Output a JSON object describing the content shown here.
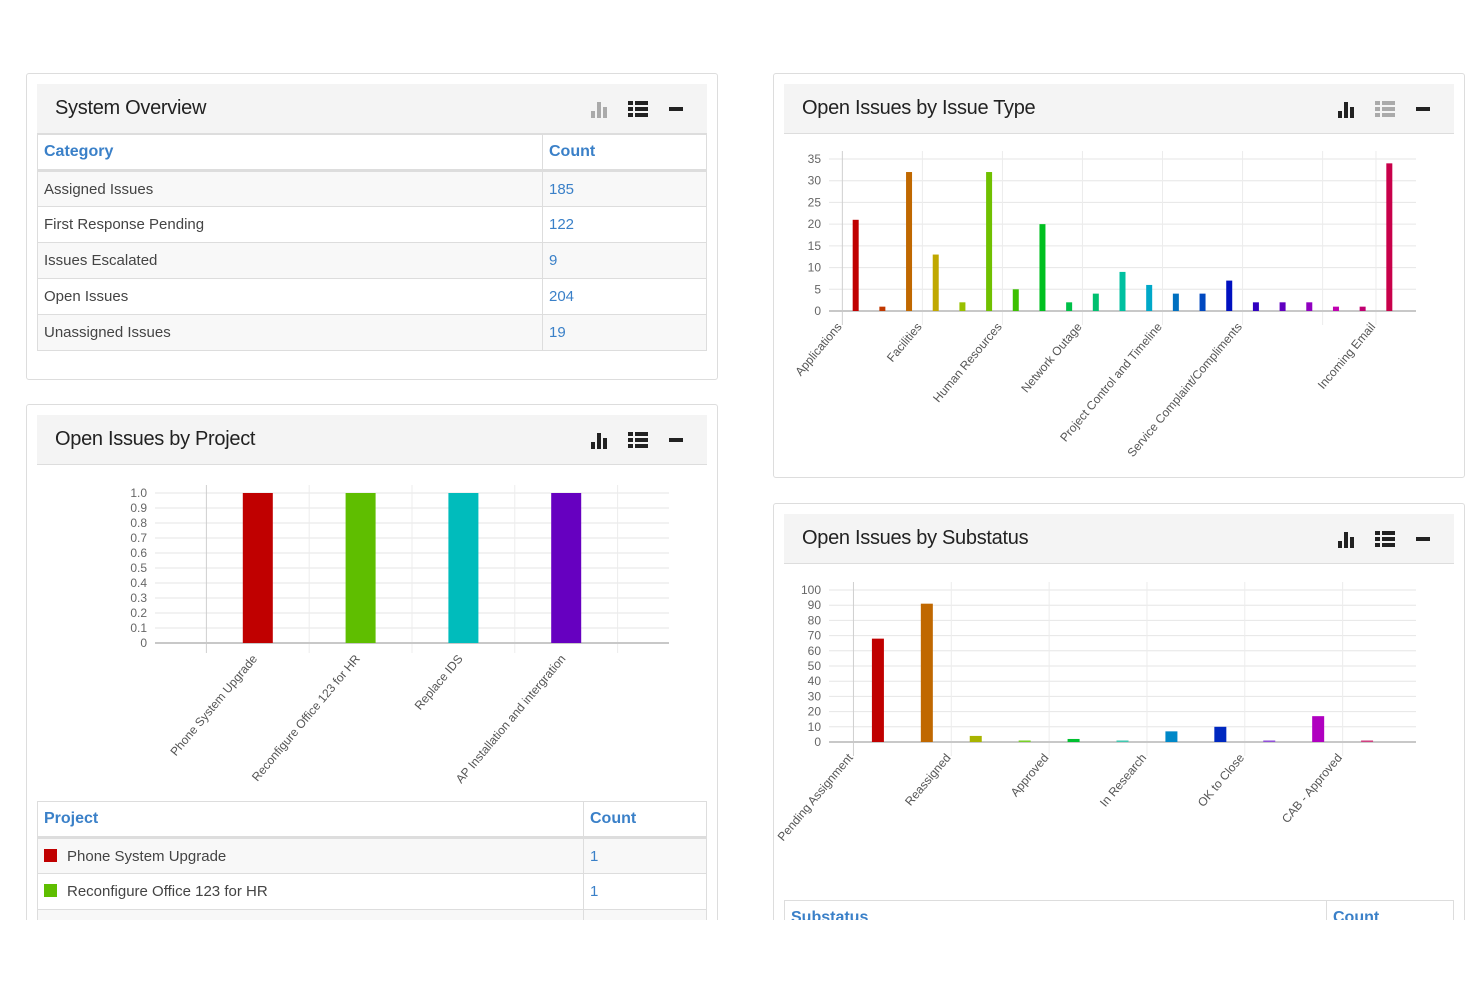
{
  "panels": {
    "system_overview": {
      "title": "System Overview",
      "columns": [
        "Category",
        "Count"
      ],
      "rows": [
        {
          "category": "Assigned Issues",
          "count": "185"
        },
        {
          "category": "First Response Pending",
          "count": "122"
        },
        {
          "category": "Issues Escalated",
          "count": "9"
        },
        {
          "category": "Open Issues",
          "count": "204"
        },
        {
          "category": "Unassigned Issues",
          "count": "19"
        }
      ],
      "active_view": "table"
    },
    "by_project": {
      "title": "Open Issues by Project",
      "columns": [
        "Project",
        "Count"
      ],
      "rows": [
        {
          "project": "Phone System Upgrade",
          "count": "1",
          "color": "#c00000"
        },
        {
          "project": "Reconfigure Office 123 for HR",
          "count": "1",
          "color": "#5fbe00"
        }
      ],
      "active_view": "chart+table"
    },
    "by_issue_type": {
      "title": "Open Issues by Issue Type",
      "active_view": "chart"
    },
    "by_substatus": {
      "title": "Open Issues by Substatus",
      "columns": [
        "Substatus",
        "Count"
      ],
      "active_view": "chart+table"
    }
  },
  "tools": {
    "chart_icon": "bar-chart-icon",
    "table_icon": "list-icon",
    "minimize_icon": "minus-icon"
  },
  "chart_data": [
    {
      "id": "by_project",
      "type": "bar",
      "title": "Open Issues by Project",
      "categories": [
        "Phone System Upgrade",
        "Reconfigure Office 123 for HR",
        "Replace IDS",
        "AP Installation and intergration"
      ],
      "values": [
        1,
        1,
        1,
        1
      ],
      "colors": [
        "#c00000",
        "#5fbe00",
        "#00bcbc",
        "#6600c0"
      ],
      "ylim": [
        0,
        1.0
      ],
      "yticks": [
        "0",
        "0.1",
        "0.2",
        "0.3",
        "0.4",
        "0.5",
        "0.6",
        "0.7",
        "0.8",
        "0.9",
        "1.0"
      ],
      "xlabel": "",
      "ylabel": "",
      "grid": true,
      "legend": "none"
    },
    {
      "id": "by_issue_type",
      "type": "bar",
      "title": "Open Issues by Issue Type",
      "categories": [
        "Applications",
        "",
        "",
        "Facilities",
        "",
        "",
        "Human Resources",
        "",
        "",
        "Network Outage",
        "",
        "",
        "Project Control and Timeline",
        "",
        "",
        "Service Complaint/Compliments",
        "",
        "",
        "",
        "",
        "Incoming Email"
      ],
      "values": [
        21,
        1,
        32,
        13,
        2,
        32,
        5,
        20,
        2,
        4,
        9,
        6,
        4,
        4,
        7,
        2,
        2,
        2,
        1,
        1,
        34
      ],
      "colors": [
        "#c00000",
        "#c03800",
        "#c06800",
        "#c0a800",
        "#98c000",
        "#70c000",
        "#3cc000",
        "#00c020",
        "#00c048",
        "#00c070",
        "#00c0a0",
        "#00a8c8",
        "#0070c0",
        "#0048c0",
        "#0010c0",
        "#3000c0",
        "#6000c0",
        "#9000c0",
        "#c000b0",
        "#c00070",
        "#c8004a"
      ],
      "ylim": [
        0,
        35
      ],
      "yticks": [
        "0",
        "5",
        "10",
        "15",
        "20",
        "25",
        "30",
        "35"
      ],
      "xlabel": "",
      "ylabel": "",
      "grid": true,
      "legend": "none"
    },
    {
      "id": "by_substatus",
      "type": "bar",
      "title": "Open Issues by Substatus",
      "categories": [
        "Pending Assignment",
        "",
        "Reassigned",
        "",
        "Approved",
        "",
        "In Research",
        "",
        "OK to Close",
        "",
        "CAB - Approved"
      ],
      "values": [
        68,
        91,
        4,
        1,
        2,
        1,
        7,
        10,
        1,
        17,
        1
      ],
      "colors": [
        "#c00000",
        "#c06800",
        "#a8b400",
        "#78d028",
        "#00c030",
        "#40c8b0",
        "#0088c8",
        "#0028c0",
        "#9050d8",
        "#b000c0",
        "#d04080"
      ],
      "ylim": [
        0,
        100
      ],
      "yticks": [
        "0",
        "10",
        "20",
        "30",
        "40",
        "50",
        "60",
        "70",
        "80",
        "90",
        "100"
      ],
      "xlabel": "",
      "ylabel": "",
      "grid": true,
      "legend": "none"
    }
  ]
}
